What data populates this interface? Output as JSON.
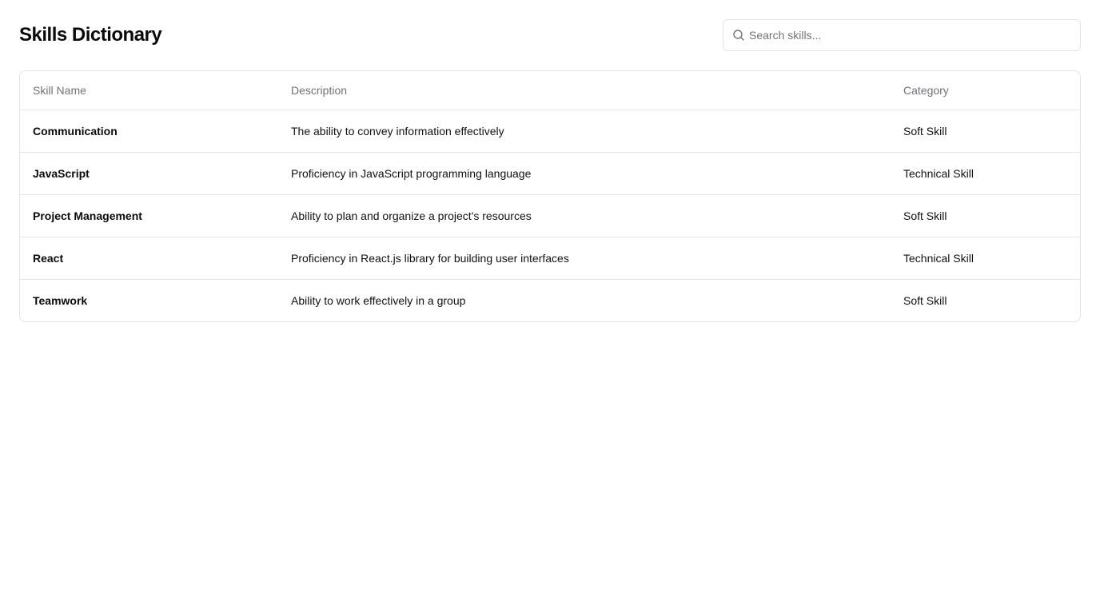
{
  "page": {
    "title": "Skills Dictionary"
  },
  "search": {
    "placeholder": "Search skills...",
    "value": ""
  },
  "table": {
    "headers": {
      "name": "Skill Name",
      "description": "Description",
      "category": "Category"
    },
    "rows": [
      {
        "name": "Communication",
        "description": "The ability to convey information effectively",
        "category": "Soft Skill"
      },
      {
        "name": "JavaScript",
        "description": "Proficiency in JavaScript programming language",
        "category": "Technical Skill"
      },
      {
        "name": "Project Management",
        "description": "Ability to plan and organize a project's resources",
        "category": "Soft Skill"
      },
      {
        "name": "React",
        "description": "Proficiency in React.js library for building user interfaces",
        "category": "Technical Skill"
      },
      {
        "name": "Teamwork",
        "description": "Ability to work effectively in a group",
        "category": "Soft Skill"
      }
    ]
  },
  "icons": {
    "search": "search-icon"
  },
  "colors": {
    "border": "#e4e4e7",
    "muted_text": "#71717a",
    "text": "#0a0a0a"
  }
}
